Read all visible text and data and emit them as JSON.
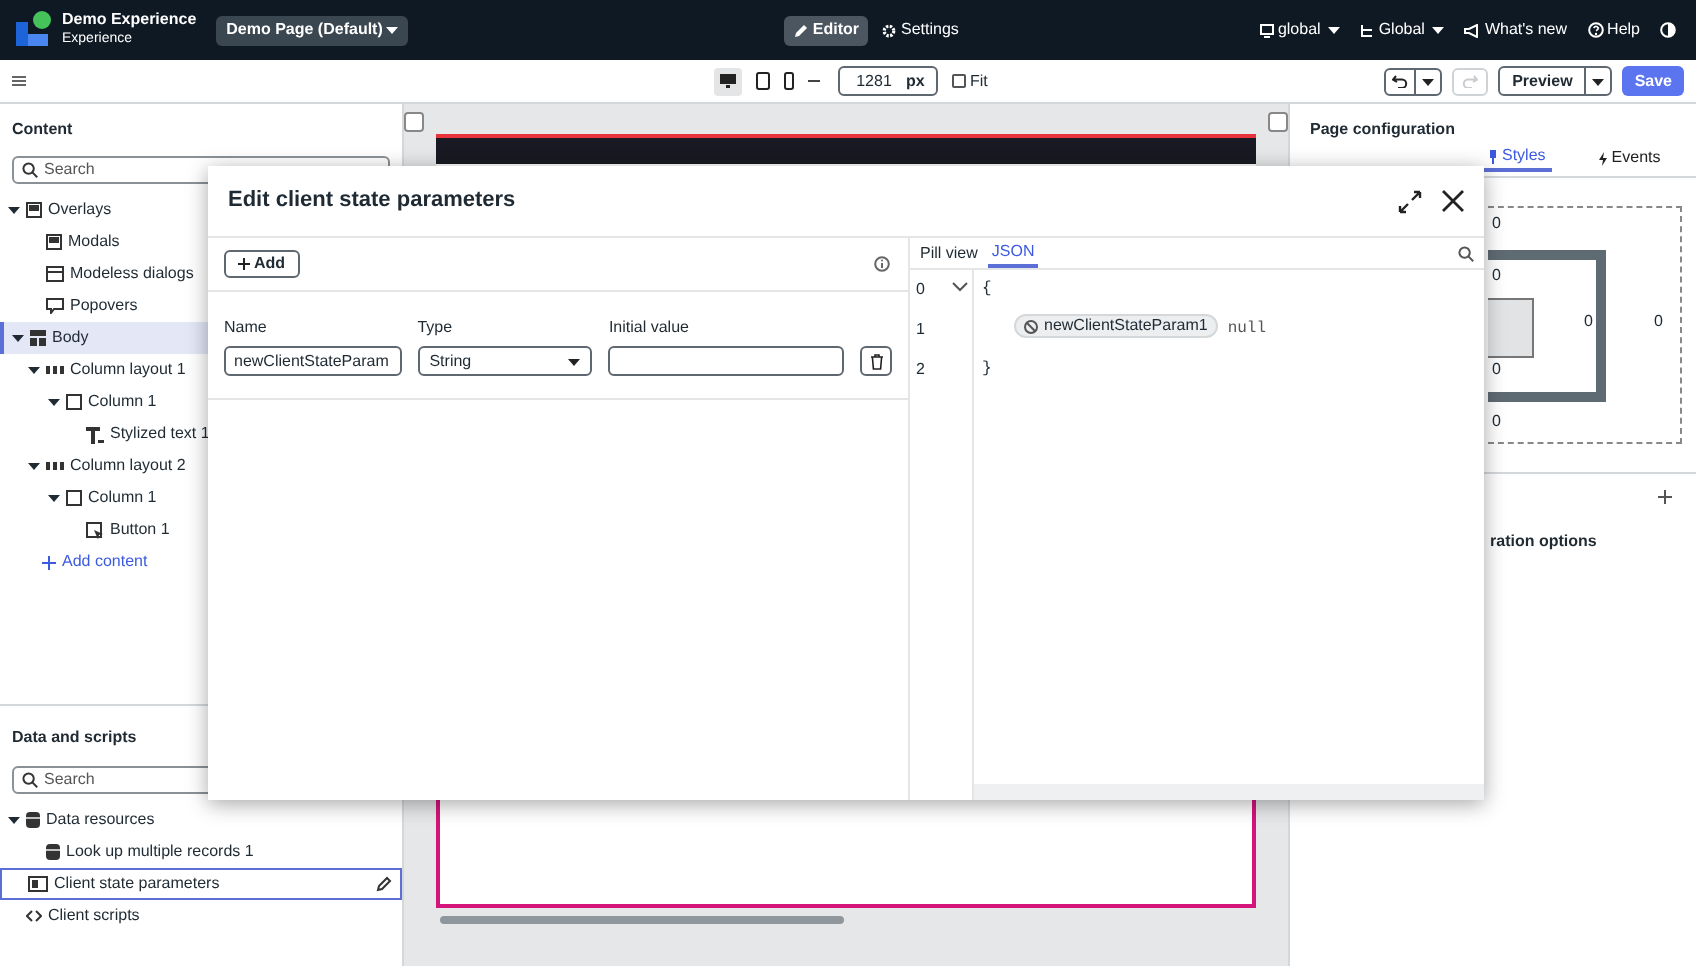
{
  "header": {
    "app_title": "Demo Experience",
    "app_subtitle": "Experience",
    "page_selector": "Demo Page (Default)",
    "scope": "global",
    "application": "Global",
    "whats_new": "What's new",
    "help": "Help",
    "modes": [
      {
        "label": "Editor",
        "selected": true
      },
      {
        "label": "Settings",
        "selected": false
      }
    ]
  },
  "toolbar": {
    "width_value": "1281",
    "width_unit": "px",
    "fit_label": "Fit",
    "fit_checked": false,
    "preview": "Preview",
    "save": "Save"
  },
  "content_panel": {
    "title": "Content",
    "search_placeholder": "Search",
    "add_content": "Add content",
    "tree": [
      {
        "label": "Overlays",
        "kind": "overlay",
        "expanded": true,
        "selected": false,
        "children": [
          {
            "label": "Modals",
            "kind": "modal",
            "selected": false
          },
          {
            "label": "Modeless dialogs",
            "kind": "dialog",
            "selected": false
          },
          {
            "label": "Popovers",
            "kind": "popover",
            "selected": false
          }
        ]
      },
      {
        "label": "Body",
        "kind": "body",
        "expanded": true,
        "selected": true,
        "children": [
          {
            "label": "Column layout 1",
            "kind": "columns",
            "expanded": true,
            "selected": false,
            "children": [
              {
                "label": "Column 1",
                "kind": "column",
                "expanded": true,
                "selected": false,
                "children": [
                  {
                    "label": "Stylized text 1",
                    "kind": "text",
                    "selected": false
                  }
                ]
              }
            ]
          },
          {
            "label": "Column layout 2",
            "kind": "columns",
            "expanded": true,
            "selected": false,
            "children": [
              {
                "label": "Column 1",
                "kind": "column",
                "expanded": true,
                "selected": false,
                "children": [
                  {
                    "label": "Button 1",
                    "kind": "button",
                    "selected": false
                  }
                ]
              }
            ]
          }
        ]
      }
    ]
  },
  "data_panel": {
    "title": "Data and scripts",
    "search_placeholder": "Search",
    "tree": [
      {
        "label": "Data resources",
        "kind": "database",
        "expanded": true,
        "selected": false,
        "children": [
          {
            "label": "Look up multiple records 1",
            "kind": "database",
            "selected": false
          }
        ]
      },
      {
        "label": "Client state parameters",
        "kind": "state",
        "selected": true
      },
      {
        "label": "Client scripts",
        "kind": "script",
        "selected": false
      }
    ]
  },
  "right_panel": {
    "title": "Page configuration",
    "section_label": "ration options",
    "tabs": [
      {
        "label": "Styles",
        "selected": true
      },
      {
        "label": "Events",
        "selected": false
      }
    ],
    "box_values": [
      "0",
      "0",
      "0",
      "0",
      "0",
      "0"
    ]
  },
  "modal": {
    "title": "Edit client state parameters",
    "add_button": "Add",
    "columns": [
      "Name",
      "Type",
      "Initial value"
    ],
    "params": [
      {
        "name": "newClientStateParam",
        "type": "String"
      }
    ],
    "view_tabs": [
      {
        "label": "Pill view",
        "selected": false
      },
      {
        "label": "JSON",
        "selected": true
      }
    ],
    "code_lines": [
      {
        "number": "0",
        "kind": "open",
        "text": "{"
      },
      {
        "number": "1",
        "kind": "pill",
        "key": "newClientStateParam1",
        "value": "null"
      },
      {
        "number": "2",
        "kind": "close",
        "text": "}"
      }
    ]
  }
}
